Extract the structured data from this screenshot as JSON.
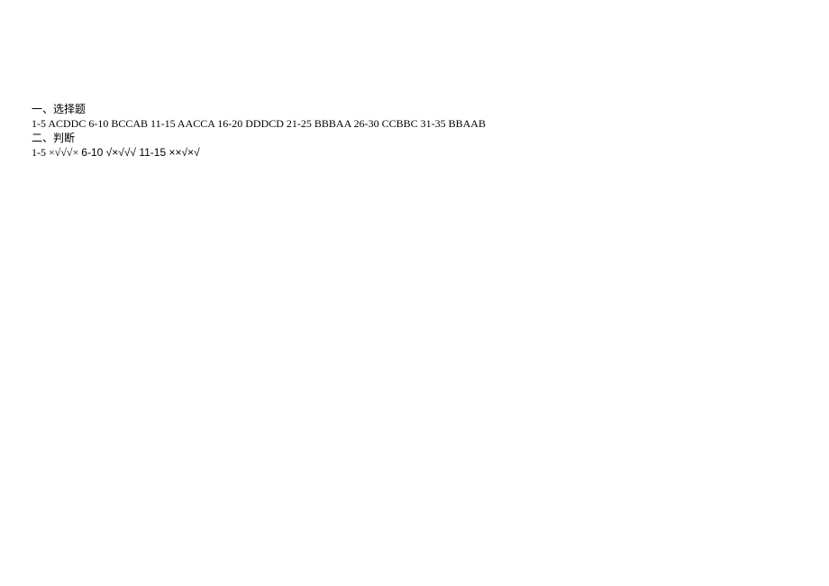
{
  "section1": {
    "heading": "一、选择题",
    "answers": "1-5 ACDDC  6-10 BCCAB 11-15 AACCA 16-20 DDDCD 21-25 BBBAA 26-30 CCBBC 31-35 BBAAB"
  },
  "section2": {
    "heading": "二、判断",
    "prefix": "1-5 ×√√√× ",
    "middle": "  6-10 √×√√√   11-15 ××√×√"
  }
}
